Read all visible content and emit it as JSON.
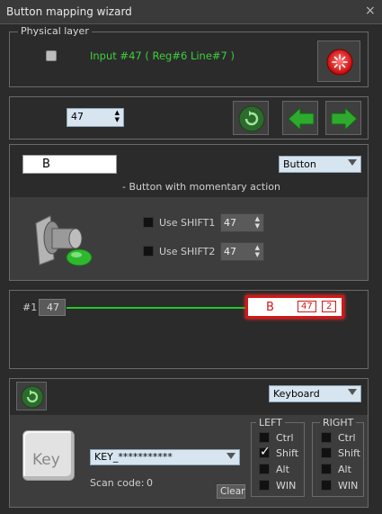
{
  "window": {
    "title": "Button mapping wizard",
    "close": "×"
  },
  "physical": {
    "legend": "Physical layer",
    "input_text": "Input #47  ( Reg#6   Line#7 )"
  },
  "nav": {
    "button_number": "47"
  },
  "config": {
    "name_value": "B",
    "type_select": "Button",
    "description": "- Button with momentary action",
    "shift1_label": "Use SHIFT1",
    "shift1_value": "47",
    "shift2_label": "Use SHIFT2",
    "shift2_value": "47"
  },
  "mapping": {
    "index_label": "#1",
    "source_value": "47",
    "target_label": "B",
    "target_badge1": "47",
    "target_badge2": "2"
  },
  "output": {
    "device_select": "Keyboard",
    "key_caption": "Key",
    "key_select": "KEY_***********",
    "scan_code_label": "Scan code:",
    "scan_code_value": "0",
    "clear_label": "Clear",
    "left": {
      "title": "LEFT",
      "ctrl": "Ctrl",
      "shift": "Shift",
      "alt": "Alt",
      "win": "WIN",
      "shift_checked": true
    },
    "right": {
      "title": "RIGHT",
      "ctrl": "Ctrl",
      "shift": "Shift",
      "alt": "Alt",
      "win": "WIN"
    }
  },
  "colors": {
    "accent_green": "#3ecf3e",
    "arrow_green": "#2eaa2e",
    "highlight_red": "#d01818"
  }
}
